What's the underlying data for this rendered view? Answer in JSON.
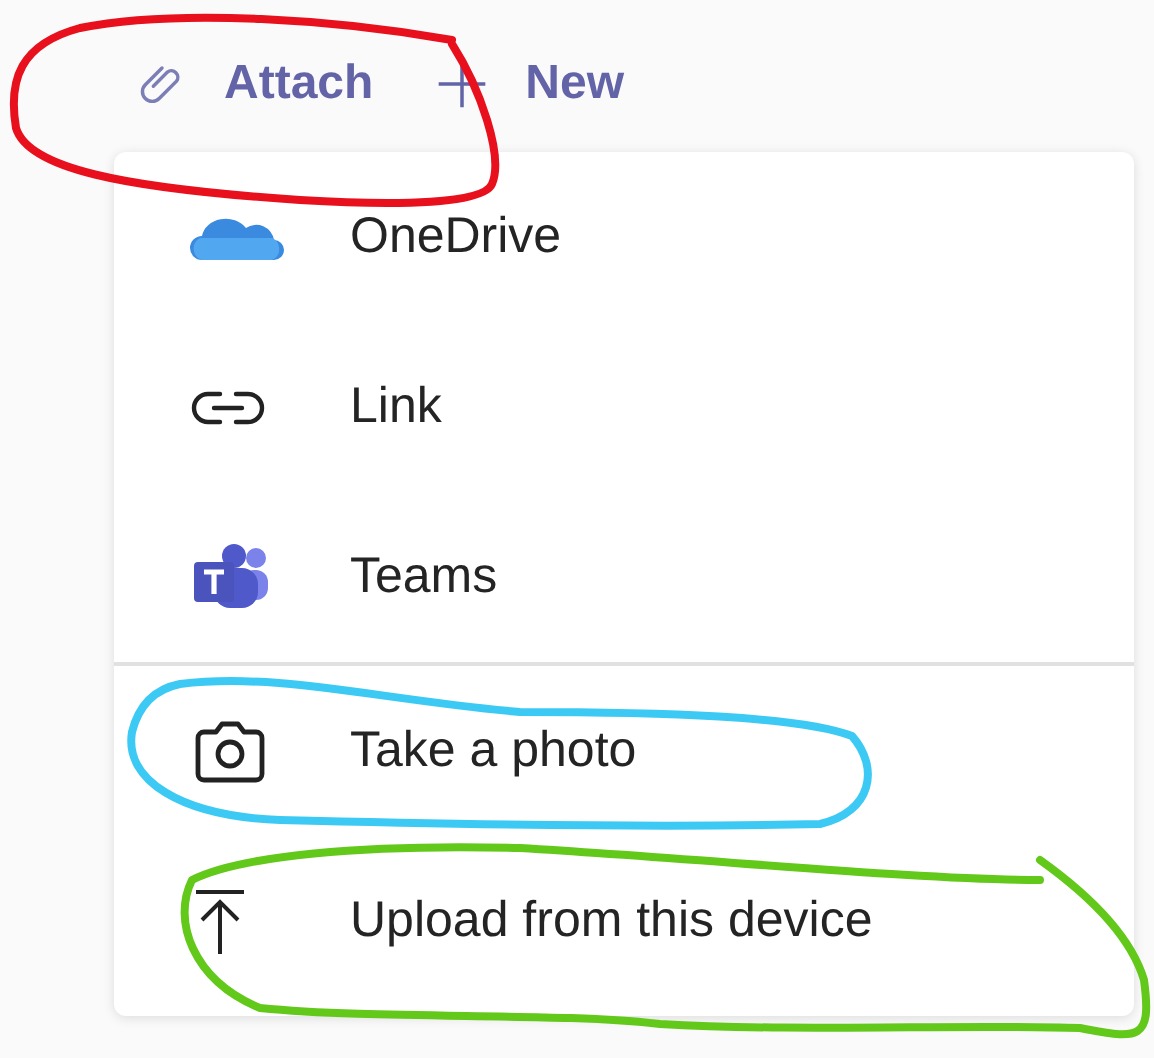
{
  "toolbar": [
    {
      "label": "Attach"
    },
    {
      "label": "New"
    }
  ],
  "menu": {
    "sections": [
      [
        {
          "label": "OneDrive"
        },
        {
          "label": "Link"
        },
        {
          "label": "Teams"
        }
      ],
      [
        {
          "label": "Take a photo"
        },
        {
          "label": "Upload from this device"
        }
      ]
    ]
  }
}
